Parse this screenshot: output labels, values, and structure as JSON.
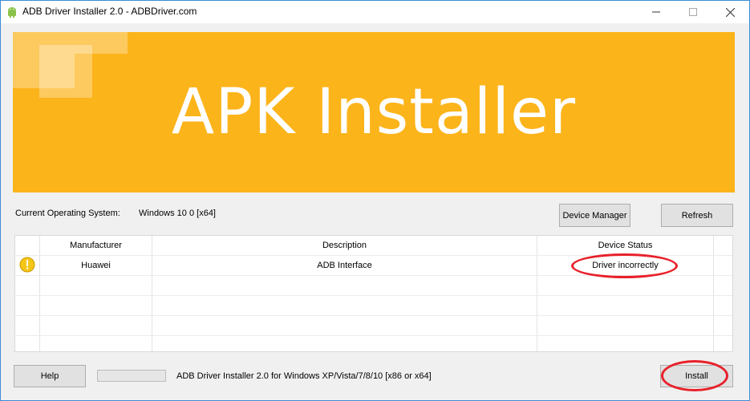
{
  "window": {
    "title": "ADB Driver Installer 2.0 - ADBDriver.com"
  },
  "banner": {
    "title": "APK Installer",
    "color": "#fcb41b"
  },
  "system": {
    "os_label": "Current Operating System:",
    "os_value": "Windows 10 0 [x64]"
  },
  "buttons": {
    "device_manager": "Device Manager",
    "refresh": "Refresh",
    "help": "Help",
    "install": "Install"
  },
  "table": {
    "columns": [
      "Manufacturer",
      "Description",
      "Device Status"
    ],
    "rows": [
      {
        "icon": "warning-icon",
        "manufacturer": "Huawei",
        "description": "ADB Interface",
        "status": "Driver incorrectly"
      }
    ]
  },
  "statusbar": {
    "text": "ADB Driver Installer 2.0 for Windows XP/Vista/7/8/10 [x86 or x64]",
    "progress": 0
  },
  "annotation_color": "#e8202a"
}
